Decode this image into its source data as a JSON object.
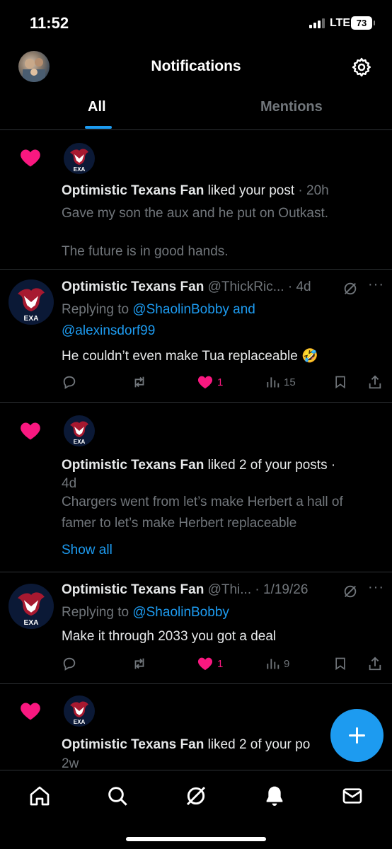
{
  "status_bar": {
    "time": "11:52",
    "network": "LTE",
    "battery": "73"
  },
  "header": {
    "title": "Notifications",
    "tabs": [
      {
        "label": "All",
        "active": true
      },
      {
        "label": "Mentions",
        "active": false
      }
    ]
  },
  "colors": {
    "accent": "#1d9bf0",
    "like": "#f91880",
    "muted": "#71767b",
    "background": "#000000"
  },
  "notifications": [
    {
      "type": "like",
      "user": "Optimistic Texans Fan",
      "action": "liked your post",
      "time": "· 20h",
      "post_line1": "Gave my son the aux and he put on Outkast.",
      "post_line2": "The future is in good hands."
    },
    {
      "type": "reply",
      "user": "Optimistic Texans Fan",
      "handle": "@ThickRic...",
      "time": "· 4d",
      "replying_prefix": "Replying to",
      "replying_to_1": "@ShaolinBobby",
      "replying_and": "and",
      "replying_to_2": "@alexinsdorf99",
      "text": "He couldn’t even make Tua replaceable 🤣",
      "likes": "1",
      "views": "15"
    },
    {
      "type": "like",
      "user": "Optimistic Texans Fan",
      "action": "liked 2 of your posts ·",
      "time": "4d",
      "post_line1": "Chargers went from let’s make Herbert a hall of",
      "post_line2": "famer to let’s make Herbert replaceable",
      "show_all": "Show all"
    },
    {
      "type": "reply",
      "user": "Optimistic Texans Fan",
      "handle": "@Thi...",
      "time": "· 1/19/26",
      "replying_prefix": "Replying to",
      "replying_to_1": "@ShaolinBobby",
      "text": "Make it through 2033 you got a deal",
      "likes": "1",
      "views": "9"
    },
    {
      "type": "like",
      "user": "Optimistic Texans Fan",
      "action": "liked 2 of your po",
      "time": "2w"
    }
  ],
  "icons": {
    "nav": [
      "home-icon",
      "search-icon",
      "grok-icon",
      "notifications-bell-icon",
      "messages-envelope-icon"
    ],
    "actions": [
      "reply-icon",
      "retweet-icon",
      "like-icon",
      "views-icon",
      "bookmark-icon",
      "share-icon"
    ]
  }
}
